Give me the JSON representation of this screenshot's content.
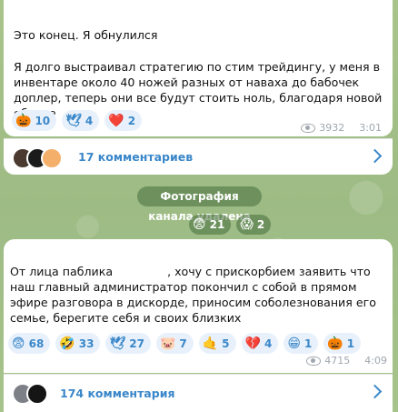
{
  "post1": {
    "title": "Это конец. Я обнулился",
    "body": "Я долго выстраивал стратегию по стим трейдингу, у меня в инвентаре около 40 ножей разных от наваха до бабочек доплер, теперь они все будут стоить ноль, благодаря новой обнове",
    "reactions": [
      {
        "emoji": "🎃",
        "count": "10"
      },
      {
        "emoji": "🕊",
        "count": "4"
      },
      {
        "emoji": "❤️",
        "count": "2"
      }
    ],
    "views": "3932",
    "time": "3:01",
    "comments_label": "17 комментариев"
  },
  "service": {
    "text": "Фотография канала удалена",
    "reactions": [
      {
        "emoji": "😨",
        "count": "21"
      },
      {
        "emoji": "😱",
        "count": "2"
      }
    ]
  },
  "post2": {
    "body_before": "От лица паблика",
    "body_after": ", хочу с прискорбием заявить что наш главный администратор покончил с собой в прямом эфире разговора в дискорде, приносим соболезнования его семье, берегите себя и своих близких",
    "reactions": [
      {
        "emoji": "😨",
        "count": "68"
      },
      {
        "emoji": "🤣",
        "count": "33"
      },
      {
        "emoji": "🕊",
        "count": "27"
      },
      {
        "emoji": "🐷",
        "count": "7"
      },
      {
        "emoji": "🤙",
        "count": "5"
      },
      {
        "emoji": "💔",
        "count": "4"
      },
      {
        "emoji": "😁",
        "count": "1"
      },
      {
        "emoji": "🎃",
        "count": "1"
      }
    ],
    "views": "4715",
    "time": "4:09",
    "comments_label": "174 комментария"
  },
  "colors": {
    "accent": "#3a87c9",
    "reaction_bg": "#e8f1fb",
    "wallpaper": "#9fbd85"
  }
}
